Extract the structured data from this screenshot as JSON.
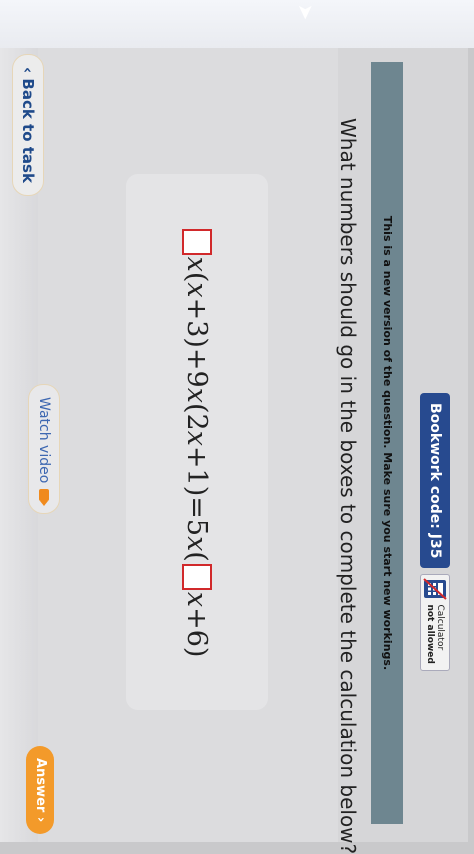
{
  "nav": {
    "back_label": "‹ Back to task"
  },
  "header": {
    "bookwork_label": "Bookwork code: J35",
    "calculator_label": "Calculator",
    "calculator_status": "not allowed",
    "notice": "This is a new version of the question. Make sure you start new workings."
  },
  "question": {
    "text": "What numbers should go in the boxes to complete the calculation below?",
    "expr": {
      "p1": "x",
      "p2": "(",
      "p3": "x",
      "p4": "+3)+9",
      "p5": "x",
      "p6": "(2",
      "p7": "x",
      "p8": "+1)=5",
      "p9": "x",
      "p10": "(",
      "p11": "x",
      "p12": "+6)"
    }
  },
  "actions": {
    "watch_video": "Watch video",
    "answer": "Answer ›"
  },
  "colors": {
    "accent": "#274a8f",
    "answer_button": "#f39a2a",
    "answer_box_border": "#d1292b",
    "notice_bar": "#6e8690"
  },
  "icons": [
    "calculator-icon",
    "video-icon",
    "chevron-left-icon",
    "chevron-right-icon"
  ]
}
